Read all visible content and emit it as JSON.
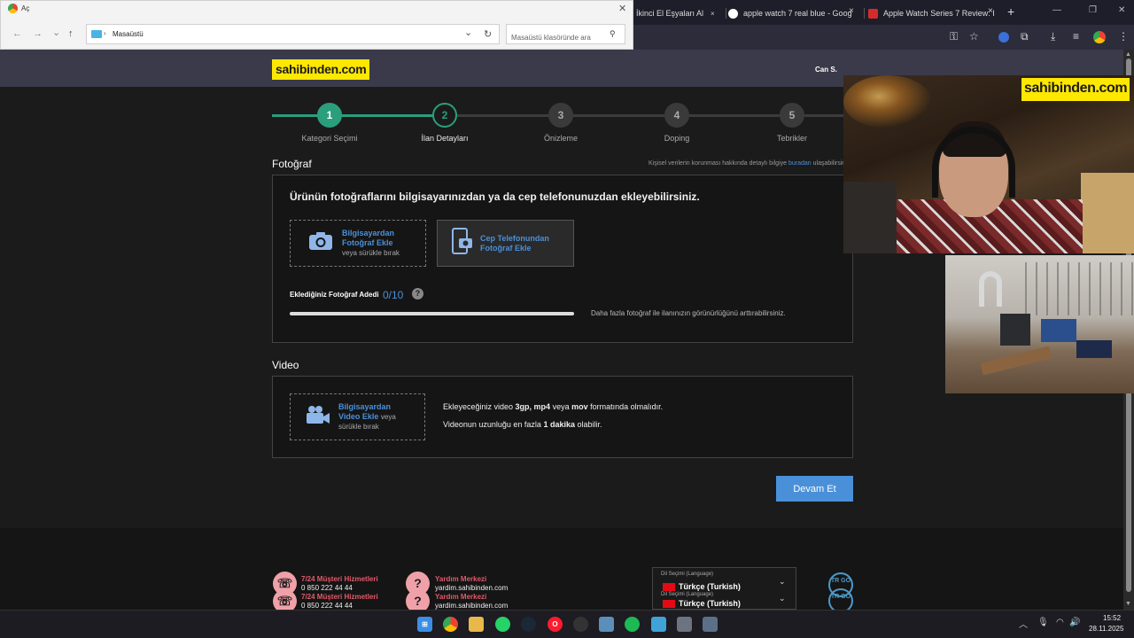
{
  "browser": {
    "tabs": [
      {
        "label": "eki İkinci El Eşyaları Al"
      },
      {
        "label": "apple watch 7 real blue - Goog"
      },
      {
        "label": "Apple Watch Series 7 Review: I"
      }
    ],
    "close_glyph": "×",
    "new_tab_glyph": "+"
  },
  "dialog": {
    "title": "Aç",
    "path": "Masaüstü",
    "search_placeholder": "Masaüstü klasöründe ara",
    "nav": {
      "back": "←",
      "forward": "→",
      "down": "⌄",
      "up": "↑",
      "refresh": "↻",
      "dropdown": "⌄"
    }
  },
  "site": {
    "logo": "sahibinden.com",
    "user": "Can S.",
    "steps": [
      {
        "num": "1",
        "label": "Kategori Seçimi",
        "state": "done"
      },
      {
        "num": "2",
        "label": "İlan Detayları",
        "state": "active"
      },
      {
        "num": "3",
        "label": "Önizleme",
        "state": "todo"
      },
      {
        "num": "4",
        "label": "Doping",
        "state": "todo"
      },
      {
        "num": "5",
        "label": "Tebrikler",
        "state": "todo"
      }
    ],
    "photo": {
      "title": "Fotoğraf",
      "privacy_text": "Kişisel verilerin korunması hakkında detaylı bilgiye ",
      "privacy_link": "buradan",
      "privacy_suffix": " ulaşabilirsin",
      "instruction": "Ürünün fotoğraflarını bilgisayarınızdan ya da cep telefonunuzdan ekleyebilirsiniz.",
      "upload_pc_line1": "Bilgisayardan",
      "upload_pc_line2": "Fotoğraf Ekle",
      "upload_pc_sub": "veya sürükle bırak",
      "upload_phone_line1": "Cep Telefonundan",
      "upload_phone_line2": "Fotoğraf Ekle",
      "count_label": "Eklediğiniz Fotoğraf Adedi",
      "count_value": "0/10",
      "count_fraction": 0,
      "help": "?",
      "more_note": "Daha fazla fotoğraf ile ilanınızın görünürlüğünü arttırabilirsiniz."
    },
    "video": {
      "title": "Video",
      "upload_line1": "Bilgisayardan",
      "upload_line2": "Video Ekle",
      "upload_sub_a": "veya",
      "upload_sub_b": "sürükle bırak",
      "info1_a": "Ekleyeceğiniz video ",
      "info1_b": "3gp, mp4",
      "info1_c": " veya ",
      "info1_d": "mov",
      "info1_e": " formatında olmalıdır.",
      "info2_a": "Videonun uzunluğu en fazla ",
      "info2_b": "1 dakika",
      "info2_c": " olabilir."
    },
    "continue_label": "Devam Et",
    "footer": {
      "support_title": "7/24 Müşteri Hizmetleri",
      "support_phone": "0 850 222 44 44",
      "help_title": "Yardım Merkezi",
      "help_url": "yardim.sahibinden.com",
      "lang_caption": "Dil Seçimi (Language)",
      "lang_value": "Türkçe (Turkish)",
      "trgo": "TR GO"
    }
  },
  "overlay": {
    "banner": "sahibinden.com"
  },
  "taskbar": {
    "time": "15:52",
    "date": "28.11.2025"
  },
  "colors": {
    "accent_green": "#2b9e7c",
    "accent_blue": "#4a90d9",
    "logo_yellow": "#ffe800"
  }
}
